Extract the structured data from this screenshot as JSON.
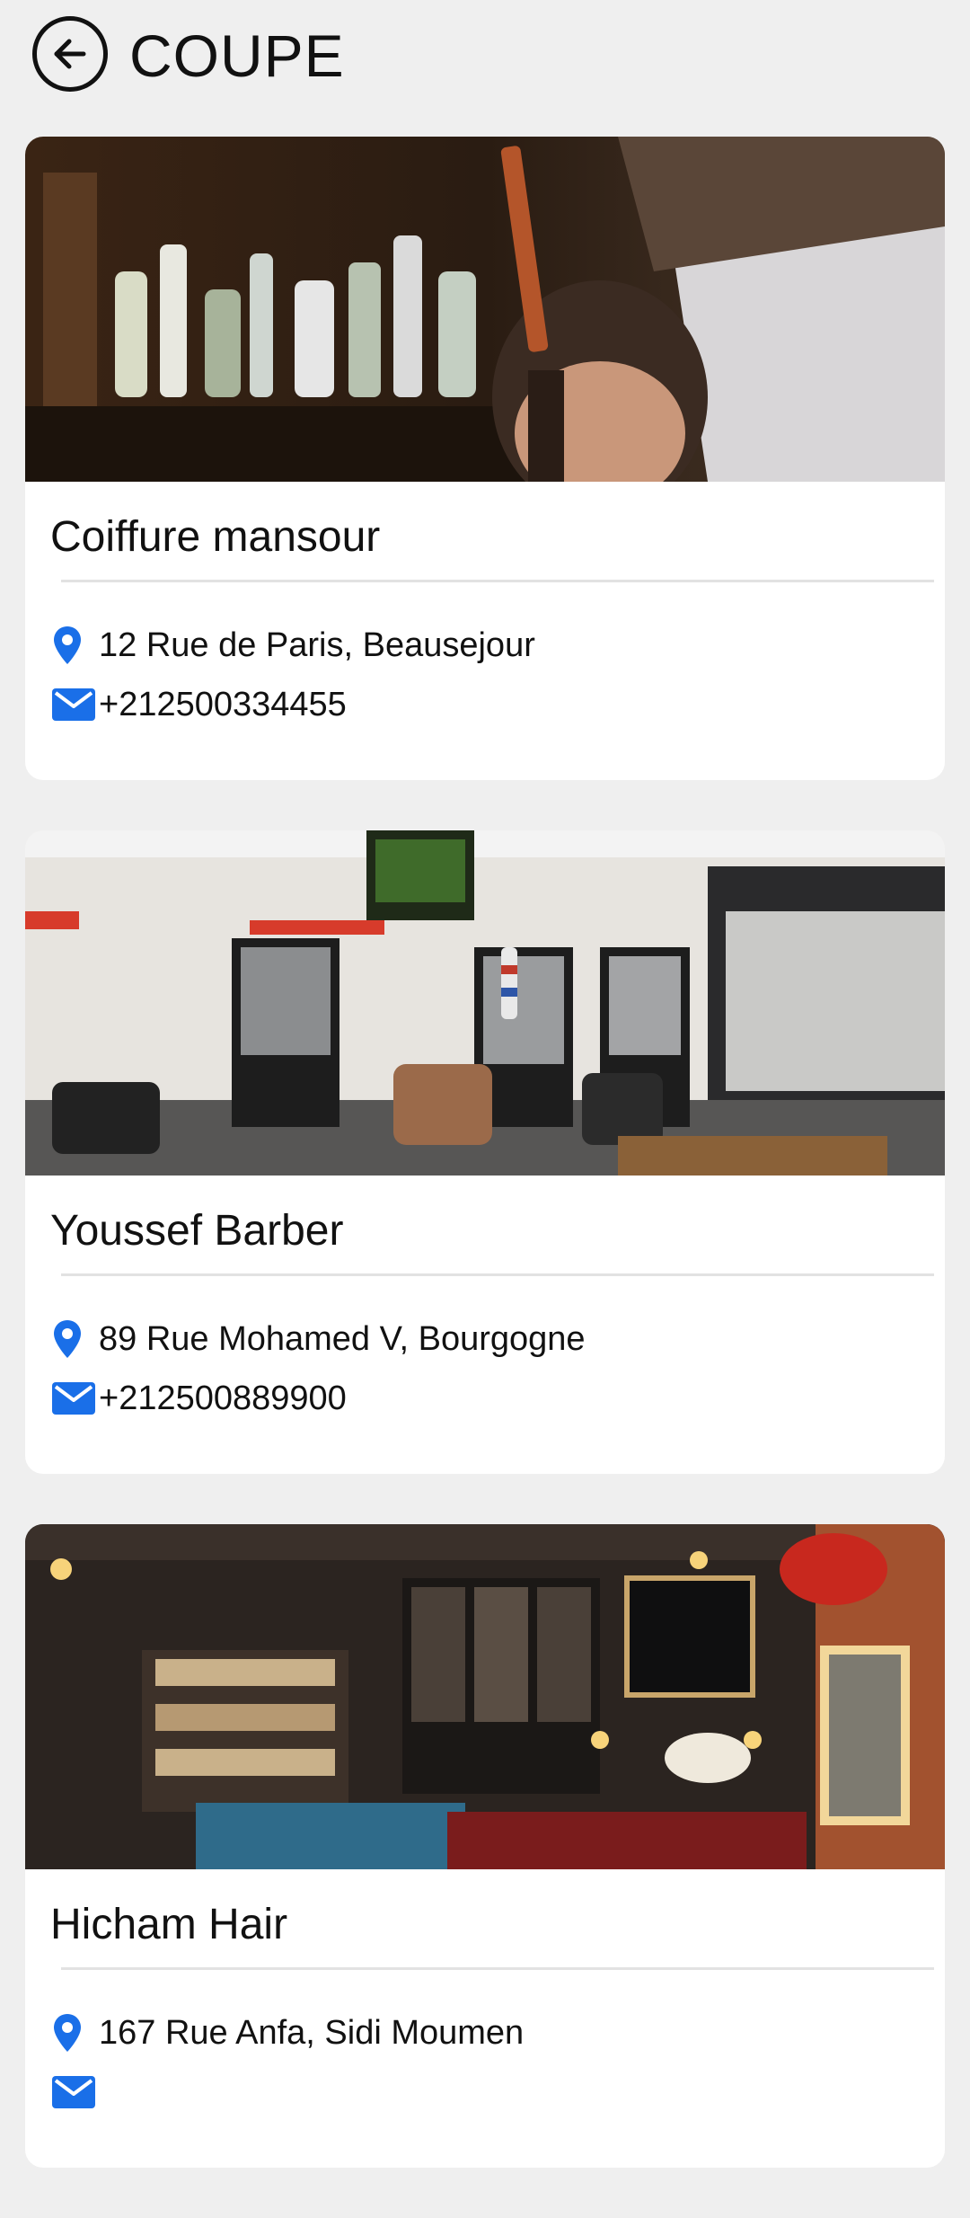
{
  "header": {
    "title": "COUPE",
    "back_icon": "arrow-left-circle-icon"
  },
  "colors": {
    "background": "#efefef",
    "card": "#ffffff",
    "icon_blue": "#1a6fe8"
  },
  "salons": [
    {
      "name": "Coiffure mansour",
      "address": "12 Rue de Paris, Beausejour",
      "phone": "+212500334455",
      "image": "barber-cutting-hair-photo"
    },
    {
      "name": "Youssef Barber",
      "address": "89 Rue Mohamed V, Bourgogne",
      "phone": "+212500889900",
      "image": "barbershop-interior-photo"
    },
    {
      "name": "Hicham Hair",
      "address": "167 Rue Anfa, Sidi Moumen",
      "phone": "",
      "image": "barber-star-lounge-photo"
    }
  ]
}
